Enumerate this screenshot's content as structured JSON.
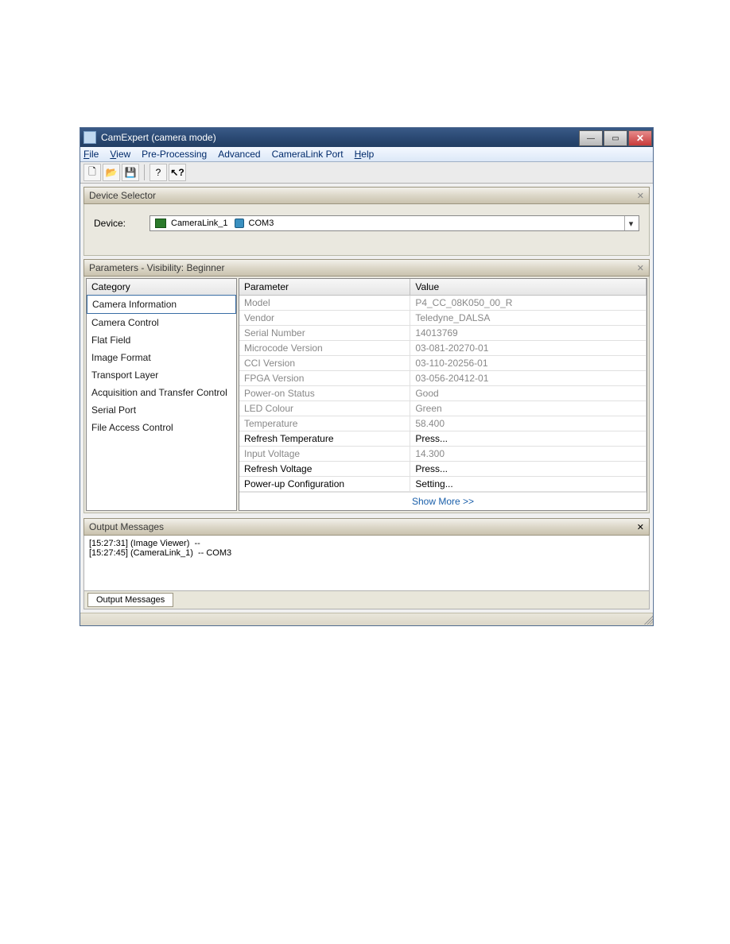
{
  "window": {
    "title": "CamExpert (camera mode)"
  },
  "menubar": {
    "items": [
      {
        "label": "File",
        "accel": "F"
      },
      {
        "label": "View",
        "accel": "V"
      },
      {
        "label": "Pre-Processing",
        "accel": ""
      },
      {
        "label": "Advanced",
        "accel": ""
      },
      {
        "label": "CameraLink Port",
        "accel": ""
      },
      {
        "label": "Help",
        "accel": "H"
      }
    ]
  },
  "toolbar": {
    "new_tip": "New",
    "open_tip": "Open",
    "save_tip": "Save",
    "help_tip": "Help",
    "context_help_tip": "Context Help"
  },
  "device_selector": {
    "panel_title": "Device Selector",
    "label": "Device:",
    "device_text_1": "CameraLink_1",
    "device_text_2": "COM3"
  },
  "params": {
    "panel_title": "Parameters - Visibility: Beginner",
    "category_header": "Category",
    "param_header": "Parameter",
    "value_header": "Value",
    "categories": [
      "Camera Information",
      "Camera Control",
      "Flat Field",
      "Image Format",
      "Transport Layer",
      "Acquisition and Transfer Control",
      "Serial Port",
      "File Access Control"
    ],
    "selected_category_index": 0,
    "rows": [
      {
        "p": "Model",
        "v": "P4_CC_08K050_00_R",
        "editable": false
      },
      {
        "p": "Vendor",
        "v": "Teledyne_DALSA",
        "editable": false
      },
      {
        "p": "Serial Number",
        "v": "14013769",
        "editable": false
      },
      {
        "p": "Microcode Version",
        "v": "03-081-20270-01",
        "editable": false
      },
      {
        "p": "CCI Version",
        "v": "03-110-20256-01",
        "editable": false
      },
      {
        "p": "FPGA Version",
        "v": "03-056-20412-01",
        "editable": false
      },
      {
        "p": "Power-on Status",
        "v": "Good",
        "editable": false
      },
      {
        "p": "LED Colour",
        "v": "Green",
        "editable": false
      },
      {
        "p": "Temperature",
        "v": "58.400",
        "editable": false
      },
      {
        "p": "Refresh Temperature",
        "v": "Press...",
        "editable": true
      },
      {
        "p": "Input Voltage",
        "v": "14.300",
        "editable": false
      },
      {
        "p": "Refresh Voltage",
        "v": "Press...",
        "editable": true
      },
      {
        "p": "Power-up Configuration",
        "v": "Setting...",
        "editable": true
      }
    ],
    "show_more": "Show More >>"
  },
  "output": {
    "panel_title": "Output Messages",
    "lines": [
      "[15:27:31] (Image Viewer)  --",
      "[15:27:45] (CameraLink_1)  -- COM3"
    ],
    "tab_label": "Output Messages"
  }
}
